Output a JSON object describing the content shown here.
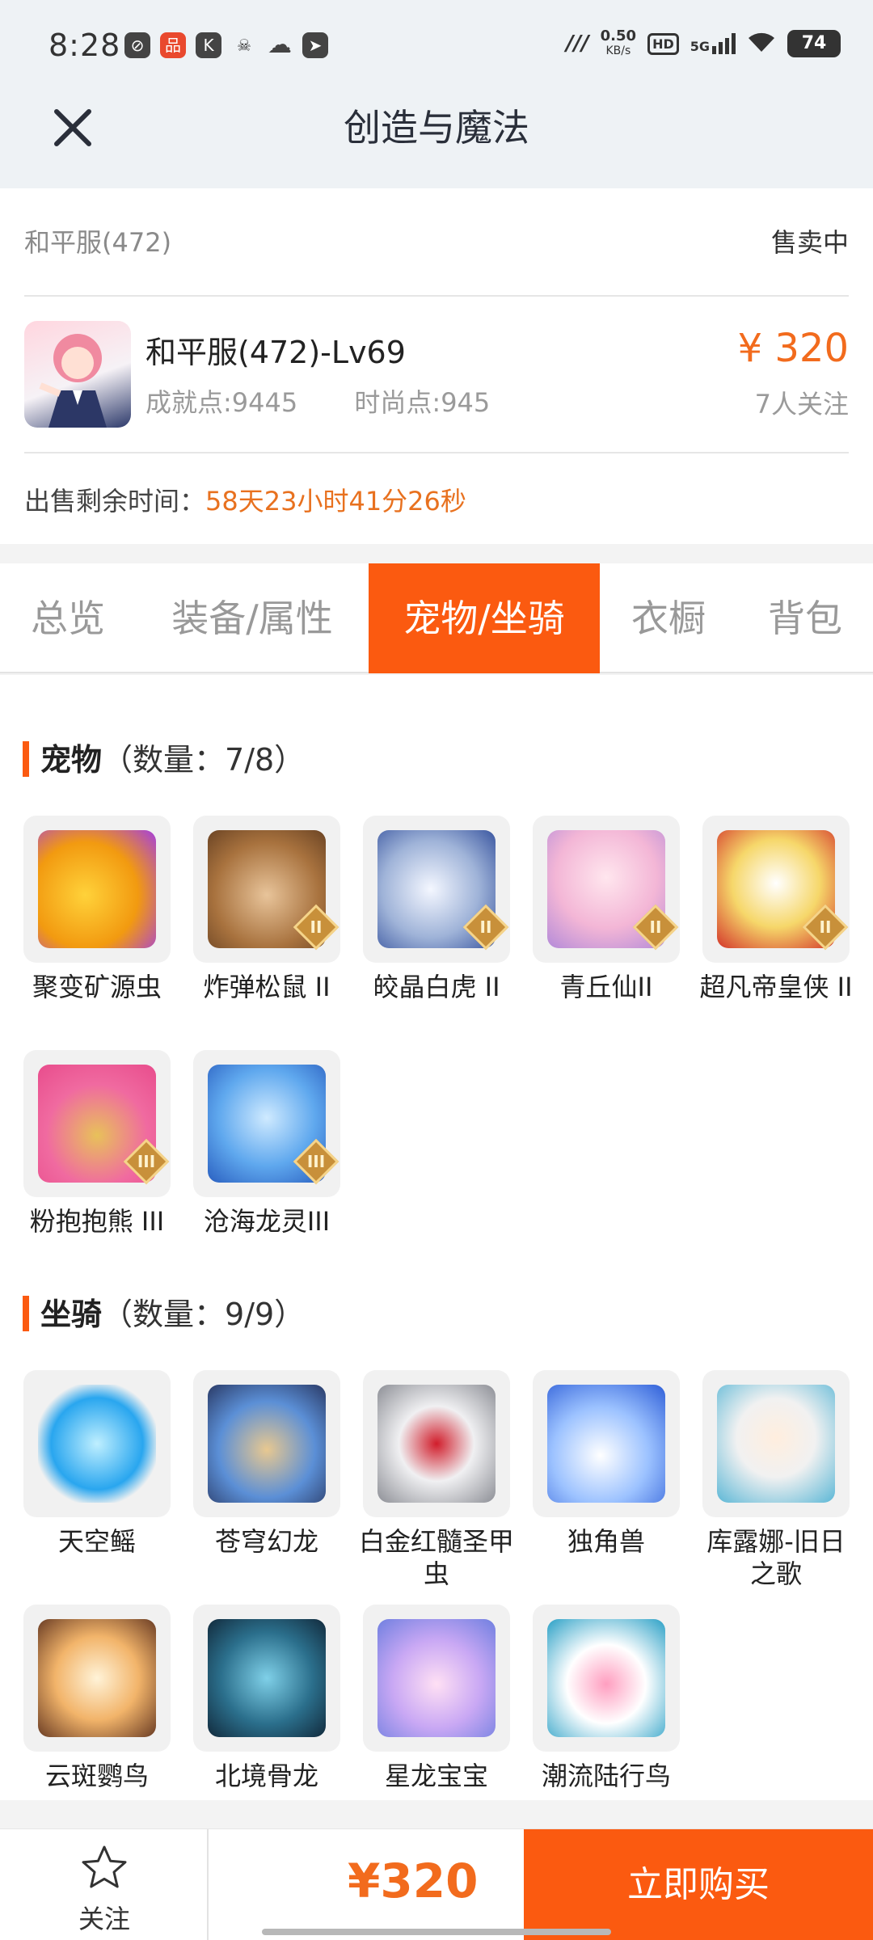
{
  "status_bar": {
    "time": "8:28",
    "net_speed_value": "0.50",
    "net_speed_unit": "KB/s",
    "hd": "HD",
    "signal": "5G",
    "battery": "74"
  },
  "header": {
    "title": "创造与魔法"
  },
  "listing": {
    "server": "和平服(472)",
    "status": "售卖中",
    "character_name": "和平服(472)-Lv69",
    "achievement": "成就点:9445",
    "fashion": "时尚点:945",
    "price": "¥ 320",
    "followers": "7人关注",
    "remaining_label": "出售剩余时间：",
    "remaining_value": "58天23小时41分26秒"
  },
  "tabs": [
    "总览",
    "装备/属性",
    "宠物/坐骑",
    "衣橱",
    "背包"
  ],
  "active_tab": 2,
  "pets": {
    "title": "宠物",
    "count": "（数量：7/8）",
    "items": [
      {
        "name": "聚变矿源虫",
        "tier": ""
      },
      {
        "name": "炸弹松鼠 II",
        "tier": "II"
      },
      {
        "name": "皎晶白虎 II",
        "tier": "II"
      },
      {
        "name": "青丘仙II",
        "tier": "II"
      },
      {
        "name": "超凡帝皇侠 II",
        "tier": "II"
      },
      {
        "name": "粉抱抱熊 III",
        "tier": "III"
      },
      {
        "name": "沧海龙灵III",
        "tier": "III"
      }
    ]
  },
  "mounts": {
    "title": "坐骑",
    "count": "（数量：9/9）",
    "items": [
      {
        "name": "天空鳐"
      },
      {
        "name": "苍穹幻龙"
      },
      {
        "name": "白金红髓圣甲虫"
      },
      {
        "name": "独角兽"
      },
      {
        "name": "库露娜-旧日之歌"
      },
      {
        "name": "云斑鹦鸟"
      },
      {
        "name": "北境骨龙"
      },
      {
        "name": "星龙宝宝"
      },
      {
        "name": "潮流陆行鸟"
      }
    ]
  },
  "bottom_bar": {
    "follow_label": "关注",
    "price": "¥320",
    "buy_label": "立即购买"
  },
  "colors": {
    "accent": "#fb5a10",
    "price": "#f26b1d"
  }
}
